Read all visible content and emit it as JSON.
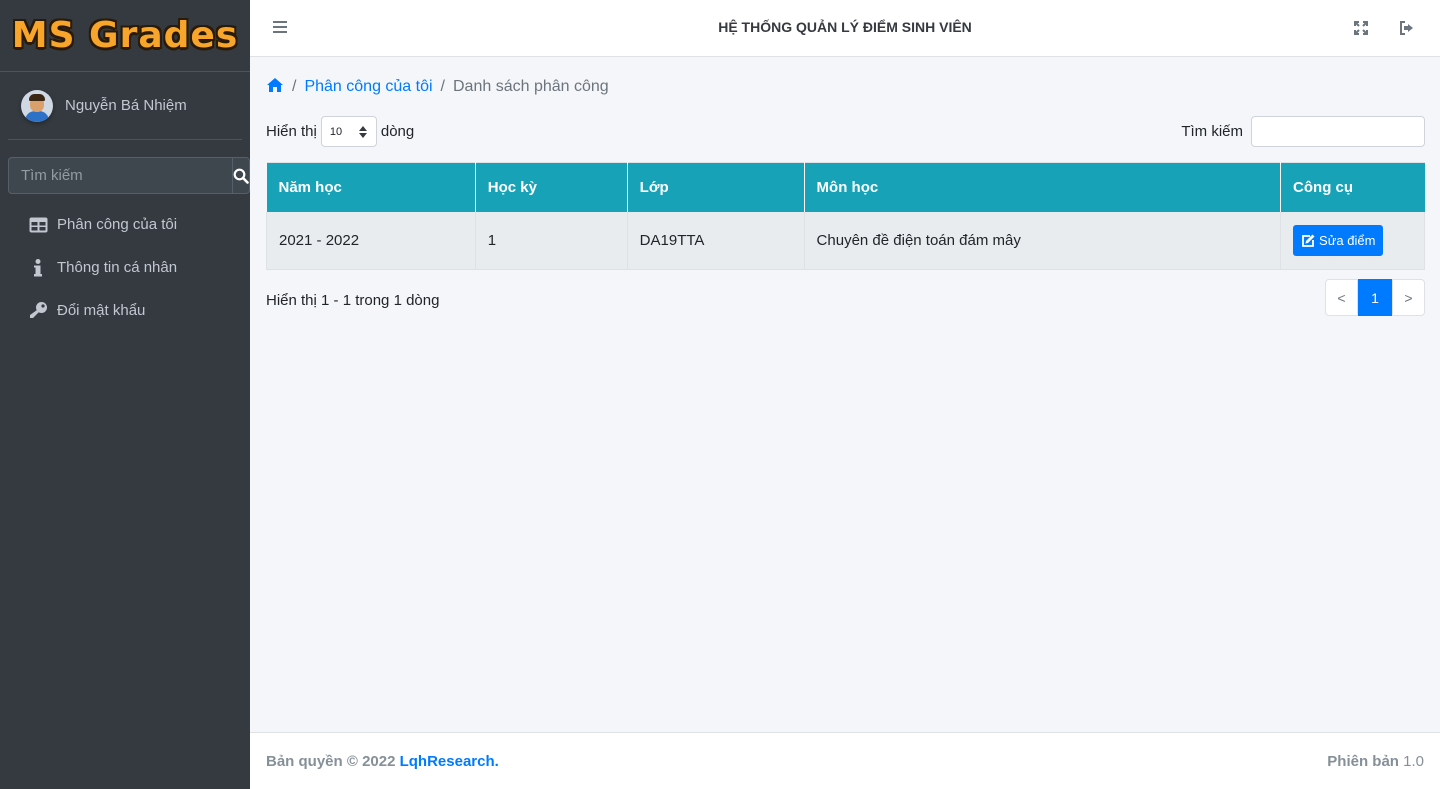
{
  "brand": {
    "title": "MS Grades"
  },
  "user": {
    "name": "Nguyễn Bá Nhiệm"
  },
  "sidebar": {
    "search_placeholder": "Tìm kiếm",
    "items": [
      {
        "label": "Phân công của tôi",
        "icon": "table-icon"
      },
      {
        "label": "Thông tin cá nhân",
        "icon": "info-icon"
      },
      {
        "label": "Đổi mật khẩu",
        "icon": "key-icon"
      }
    ]
  },
  "header": {
    "title": "HỆ THỐNG QUẢN LÝ ĐIỂM SINH VIÊN"
  },
  "breadcrumb": {
    "home_icon": "home-icon",
    "sep": "/",
    "item1": "Phân công của tôi",
    "item2": "Danh sách phân công"
  },
  "table_controls": {
    "show_label": "Hiển thị",
    "length_value": "10",
    "rows_label": "dòng",
    "search_label": "Tìm kiếm",
    "search_value": ""
  },
  "table": {
    "headers": [
      "Năm học",
      "Học kỳ",
      "Lớp",
      "Môn học",
      "Công cụ"
    ],
    "rows": [
      {
        "year": "2021 - 2022",
        "semester": "1",
        "class": "DA19TTA",
        "subject": "Chuyên đề điện toán đám mây",
        "action": "Sửa điểm"
      }
    ]
  },
  "info": {
    "text": "Hiển thị 1 - 1 trong 1 dòng"
  },
  "pagination": {
    "prev": "<",
    "current": "1",
    "next": ">"
  },
  "footer": {
    "copyright": "Bản quyền © 2022",
    "company": "LqhResearch.",
    "version_label": "Phiên bản",
    "version": "1.0"
  },
  "colors": {
    "sidebar": "#343a40",
    "accent": "#007bff",
    "table_header": "#17a2b8",
    "brand": "#f7a62b"
  }
}
